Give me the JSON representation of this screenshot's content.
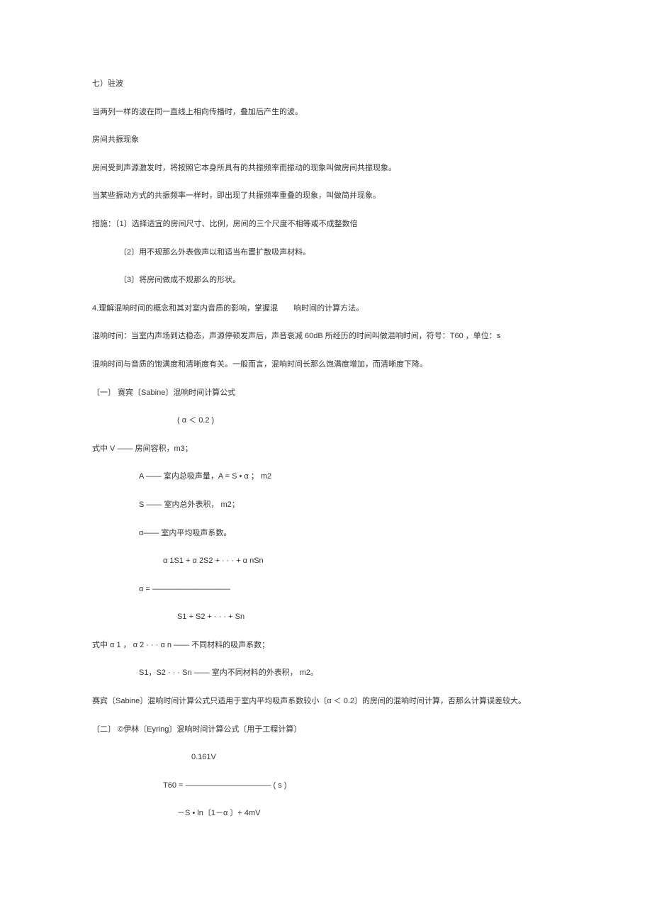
{
  "doc": {
    "p1": "七）驻波",
    "p2": "当两列一样的波在同一直线上相向传播时，叠加后产生的波。",
    "p3": "房间共振现象",
    "p4": "房间受到声源激发时，将按照它本身所具有的共振频率而振动的现象叫做房间共振现象。",
    "p5": "当某些振动方式的共振频率一样时，即出现了共振频率重叠的现象，叫做简并现象。",
    "p6": "措施：〔1〕选择适宜的房间尺寸、比例，房间的三个尺度不相等或不成整数倍",
    "p7": "〔2〕用不规那么外表做声以和适当布置扩散吸声材料。",
    "p8": "〔3〕将房间做成不规那么的形状。",
    "p9": "4.理解混响时间的概念和其对室内音质的影响，掌握混　　响时间的计算方法。",
    "p10": "混响时间：当室内声场到达稳态，声源停顿发声后，声音衰减 60dB 所经历的时间叫做混响时间，符号：T60  ，单位：s",
    "p11": "混响时间与音质的饱满度和清晰度有关。一般而言，混响时间长那么饱满度增加，而清晰度下降。",
    "p12": "〔一〕 赛宾〔Sabine〕混响时间计算公式",
    "p13": "( α ＜ 0.2 )",
    "p14": "式中   V —— 房间容积，m3；",
    "p15": "A —— 室内总吸声量，A = S • α ； m2",
    "p16": "S —— 室内总外表积， m2；",
    "p17": "α—— 室内平均吸声系数。",
    "p18": "α 1S1 + α 2S2 + · · · + α nSn",
    "p19": "α  = ——————————",
    "p20": "S1 + S2 + · · · + Sn",
    "p21": "式中 α 1 ， α 2 · · · α n —— 不同材料的吸声系数；",
    "p22": "S1，S2 · · · Sn —— 室内不同材料的外表积， m2。",
    "p23": "赛宾〔Sabine〕混响时间计算公式只适用于室内平均吸声系数较小〔α ＜ 0.2〕的房间的混响时间计算，否那么计算误差较大。",
    "p24": "〔二〕 ©伊林〔Eyring〕混响时间计算公式〔用于工程计算〕",
    "p25": "0.161V",
    "p26": "T60 = ———————————        ( s )",
    "p27": "－S • ln〔1－α 〕+ 4mV"
  }
}
